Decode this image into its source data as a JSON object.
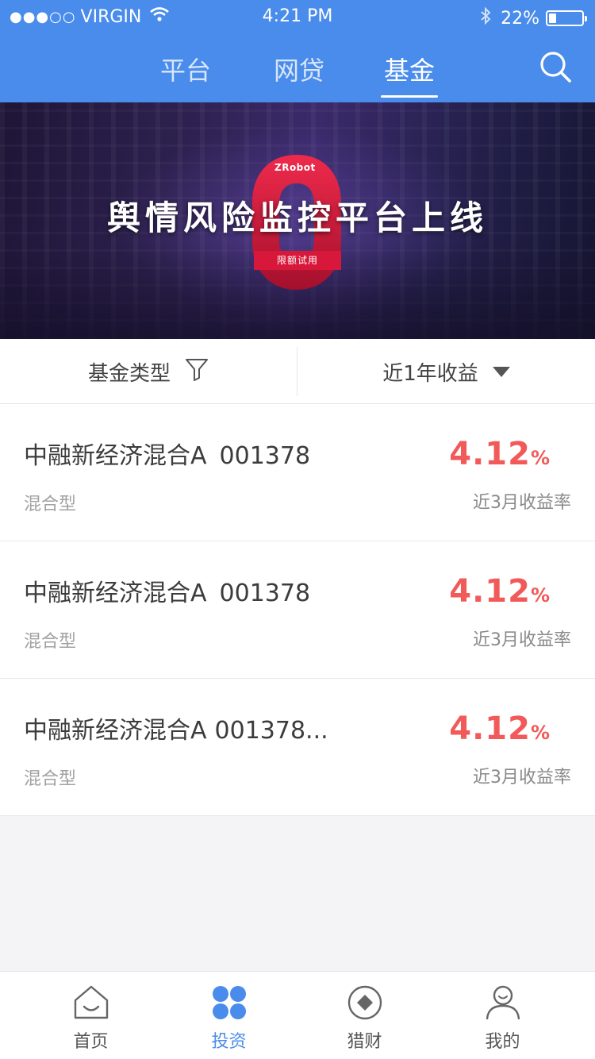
{
  "status_bar": {
    "carrier": "VIRGIN",
    "time": "4:21 PM",
    "battery": "22%",
    "battery_level": 0.22
  },
  "nav": {
    "tabs": [
      {
        "label": "平台"
      },
      {
        "label": "网贷"
      },
      {
        "label": "基金",
        "active": true
      }
    ],
    "search_icon": "search-icon"
  },
  "banner": {
    "brand": "ZRobot",
    "headline": "舆情风险监控平台上线",
    "button": "限额试用"
  },
  "filters": {
    "fund_type": "基金类型",
    "sort": "近1年收益"
  },
  "funds": [
    {
      "name": "中融新经济混合A",
      "code": "001378",
      "type": "混合型",
      "rate": "4.12",
      "unit": "%",
      "rate_label": "近3月收益率"
    },
    {
      "name": "中融新经济混合A",
      "code": "001378",
      "type": "混合型",
      "rate": "4.12",
      "unit": "%",
      "rate_label": "近3月收益率"
    },
    {
      "name": "中融新经济混合A",
      "code": "001378...",
      "type": "混合型",
      "rate": "4.12",
      "unit": "%",
      "rate_label": "近3月收益率"
    }
  ],
  "tabbar": {
    "items": [
      {
        "label": "首页",
        "icon": "home-icon"
      },
      {
        "label": "投资",
        "icon": "invest-icon",
        "active": true
      },
      {
        "label": "猎财",
        "icon": "hunt-icon"
      },
      {
        "label": "我的",
        "icon": "user-icon"
      }
    ]
  },
  "colors": {
    "primary": "#4a8ceb",
    "accent_red": "#f25a5a",
    "banner_button": "#d8183a"
  }
}
